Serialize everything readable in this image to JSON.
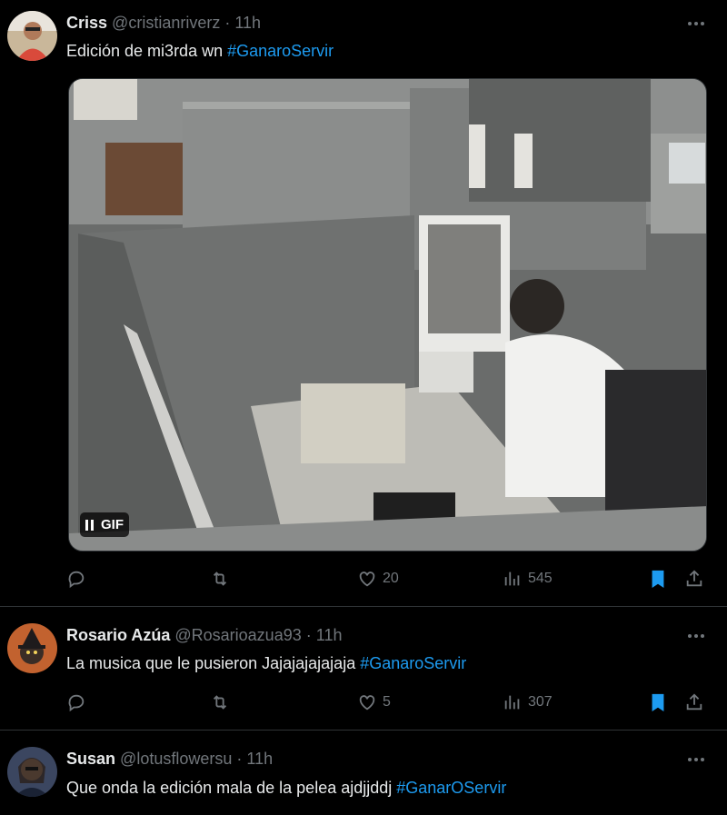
{
  "tweets": [
    {
      "name": "Criss",
      "handle": "@cristianriverz",
      "time": "11h",
      "text": "Edición de mi3rda wn ",
      "hashtag": "#GanaroServir",
      "media_badge": "GIF",
      "likes": "20",
      "views": "545"
    },
    {
      "name": "Rosario Azúa",
      "handle": "@Rosarioazua93",
      "time": "11h",
      "text": "La musica que le pusieron Jajajajajajaja  ",
      "hashtag": "#GanaroServir",
      "likes": "5",
      "views": "307"
    },
    {
      "name": "Susan",
      "handle": "@lotusflowersu",
      "time": "11h",
      "text": "Que onda la edición mala de la pelea ajdjjddj ",
      "hashtag": "#GanarOServir"
    }
  ],
  "separator": "·",
  "colors": {
    "accent": "#1d9bf0",
    "muted": "#71767b",
    "text": "#e7e9ea",
    "background": "#000000",
    "border": "#2f3336"
  },
  "icons": [
    "reply-icon",
    "retweet-icon",
    "heart-icon",
    "views-icon",
    "bookmark-icon",
    "share-icon",
    "more-icon",
    "pause-icon"
  ]
}
